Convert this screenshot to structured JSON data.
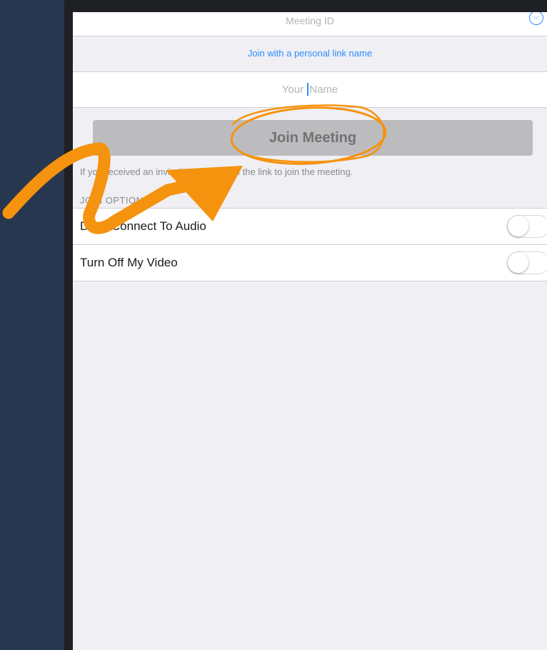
{
  "form": {
    "meeting_id_placeholder": "Meeting ID",
    "personal_link_label": "Join with a personal link name",
    "name_placeholder_before_cursor": "Your ",
    "name_placeholder_after_cursor": "Name",
    "join_button_label": "Join Meeting",
    "hint_text": "If you received an invitation link, tap on the link to join the meeting."
  },
  "join_options": {
    "header": "JOIN OPTIONS",
    "items": [
      {
        "label": "Don't Connect To Audio",
        "enabled": false
      },
      {
        "label": "Turn Off My Video",
        "enabled": false
      }
    ]
  },
  "icons": {
    "dropdown": "chevron-down-icon",
    "annotation": "orange-arrow-icon"
  },
  "colors": {
    "accent": "#2d8cff",
    "annotation": "#f5930f",
    "background": "#283750",
    "disabled_button": "#bcbcbf"
  }
}
